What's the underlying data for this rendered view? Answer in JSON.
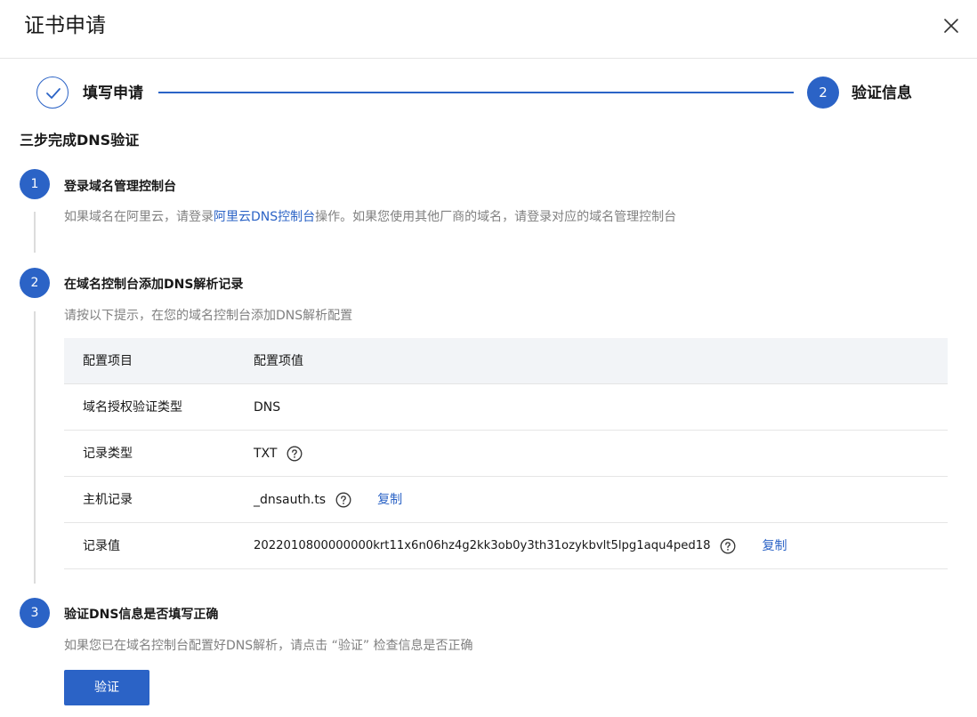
{
  "dialog": {
    "title": "证书申请",
    "close_icon": "close-icon"
  },
  "steps": [
    {
      "label": "填写申请",
      "status": "done",
      "icon": "check-icon"
    },
    {
      "number": "2",
      "label": "验证信息",
      "status": "active"
    }
  ],
  "section_title": "三步完成DNS验证",
  "step1": {
    "number": "1",
    "title": "登录域名管理控制台",
    "desc_pre": "如果域名在阿里云，请登录",
    "desc_link": "阿里云DNS控制台",
    "desc_post": "操作。如果您使用其他厂商的域名，请登录对应的域名管理控制台"
  },
  "step2": {
    "number": "2",
    "title": "在域名控制台添加DNS解析记录",
    "desc": "请按以下提示，在您的域名控制台添加DNS解析配置",
    "table": {
      "headers": [
        "配置项目",
        "配置项值"
      ],
      "rows": [
        {
          "key": "域名授权验证类型",
          "value": "DNS"
        },
        {
          "key": "记录类型",
          "value": "TXT",
          "help_icon": "question-circle-icon"
        },
        {
          "key": "主机记录",
          "value": "_dnsauth.ts",
          "help_icon": "question-circle-icon",
          "action": "复制"
        },
        {
          "key": "记录值",
          "value": "2022010800000000krt11x6n06hz4g2kk3ob0y3th31ozykbvlt5lpg1aqu4ped18",
          "help_icon": "question-circle-icon",
          "action": "复制"
        }
      ]
    }
  },
  "step3": {
    "number": "3",
    "title": "验证DNS信息是否填写正确",
    "desc": "如果您已在域名控制台配置好DNS解析，请点击 “验证” 检查信息是否正确",
    "button": "验证"
  },
  "colors": {
    "primary": "#2b63c6",
    "muted_text": "#808080",
    "table_header_bg": "#f2f4f7"
  }
}
